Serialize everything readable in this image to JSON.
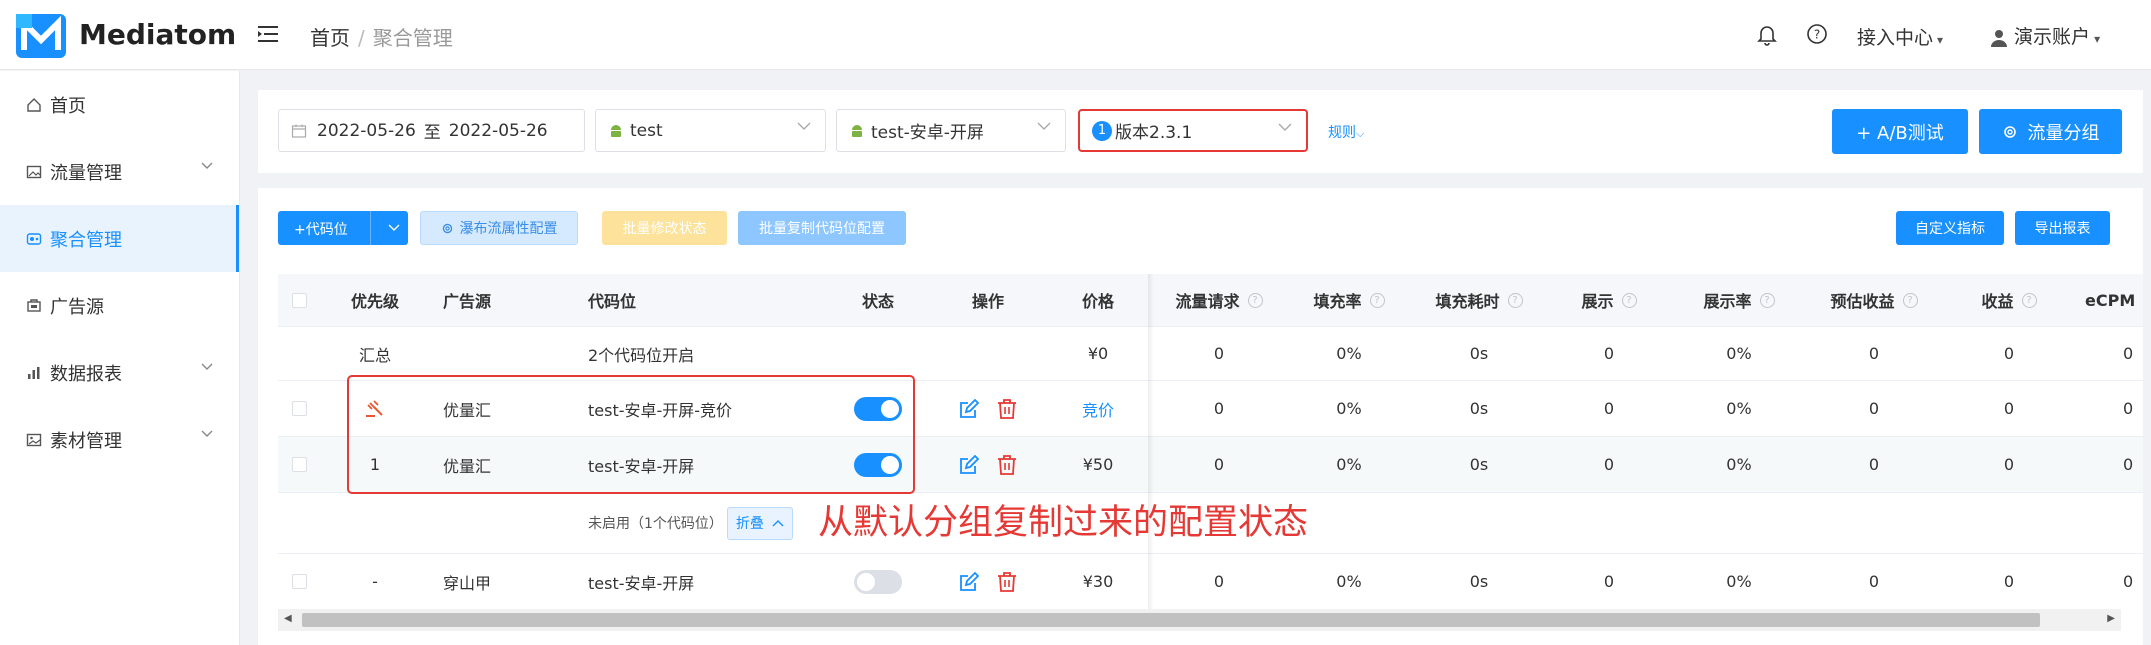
{
  "header": {
    "brand": "Mediatom",
    "breadcrumb": [
      "首页",
      "/",
      "聚合管理"
    ],
    "access_label": "接入中心",
    "user_label": "演示账户"
  },
  "sidebar": {
    "items": [
      {
        "label": "首页",
        "icon": "home-icon",
        "expandable": false,
        "active": false
      },
      {
        "label": "流量管理",
        "icon": "image-icon",
        "expandable": true,
        "active": false
      },
      {
        "label": "聚合管理",
        "icon": "aggregate-icon",
        "expandable": false,
        "active": true
      },
      {
        "label": "广告源",
        "icon": "ad-source-icon",
        "expandable": false,
        "active": false
      },
      {
        "label": "数据报表",
        "icon": "bar-chart-icon",
        "expandable": true,
        "active": false
      },
      {
        "label": "素材管理",
        "icon": "picture-icon",
        "expandable": true,
        "active": false
      }
    ]
  },
  "filters": {
    "date_start": "2022-05-26",
    "date_sep": "至",
    "date_end": "2022-05-26",
    "app": "test",
    "slot": "test-安卓-开屏",
    "version_badge": "1",
    "version": "版本2.3.1",
    "rule_link": "规则",
    "ab_button": "+ A/B测试",
    "group_button": "流量分组"
  },
  "toolbar": {
    "add_slot": "+代码位",
    "waterfall_config": "瀑布流属性配置",
    "batch_status": "批量修改状态",
    "batch_copy": "批量复制代码位配置",
    "custom_metric": "自定义指标",
    "export": "导出报表"
  },
  "table": {
    "headers": {
      "priority": "优先级",
      "source": "广告源",
      "slot": "代码位",
      "status": "状态",
      "ops": "操作",
      "price": "价格",
      "requests": "流量请求",
      "fill_rate": "填充率",
      "fill_time": "填充耗时",
      "impressions": "展示",
      "show_rate": "展示率",
      "est_revenue": "预估收益",
      "revenue": "收益",
      "ecpm": "eCPM"
    },
    "summary": {
      "label": "汇总",
      "slot": "2个代码位开启",
      "price": "¥0",
      "requests": "0",
      "fill_rate": "0%",
      "fill_time": "0s",
      "impressions": "0",
      "show_rate": "0%",
      "est_revenue": "0",
      "revenue": "0",
      "ecpm": "0"
    },
    "rows": [
      {
        "priority": "",
        "source": "优量汇",
        "slot": "test-安卓-开屏-竞价",
        "status_on": true,
        "price": "竞价",
        "requests": "0",
        "fill_rate": "0%",
        "fill_time": "0s",
        "impressions": "0",
        "show_rate": "0%",
        "est_revenue": "0",
        "revenue": "0",
        "ecpm": "0"
      },
      {
        "priority": "1",
        "source": "优量汇",
        "slot": "test-安卓-开屏",
        "status_on": true,
        "price": "¥50",
        "requests": "0",
        "fill_rate": "0%",
        "fill_time": "0s",
        "impressions": "0",
        "show_rate": "0%",
        "est_revenue": "0",
        "revenue": "0",
        "ecpm": "0"
      },
      {
        "priority": "-",
        "source": "穿山甲",
        "slot": "test-安卓-开屏",
        "status_on": false,
        "price": "¥30",
        "requests": "0",
        "fill_rate": "0%",
        "fill_time": "0s",
        "impressions": "0",
        "show_rate": "0%",
        "est_revenue": "0",
        "revenue": "0",
        "ecpm": "0"
      }
    ],
    "disabled_group": {
      "label": "未启用（1个代码位）",
      "fold": "折叠"
    }
  },
  "annotation": "从默认分组复制过来的配置状态",
  "colors": {
    "primary": "#1890ff",
    "danger": "#e53935",
    "warning": "#fce29a",
    "bid_icon": "#e8572f"
  }
}
